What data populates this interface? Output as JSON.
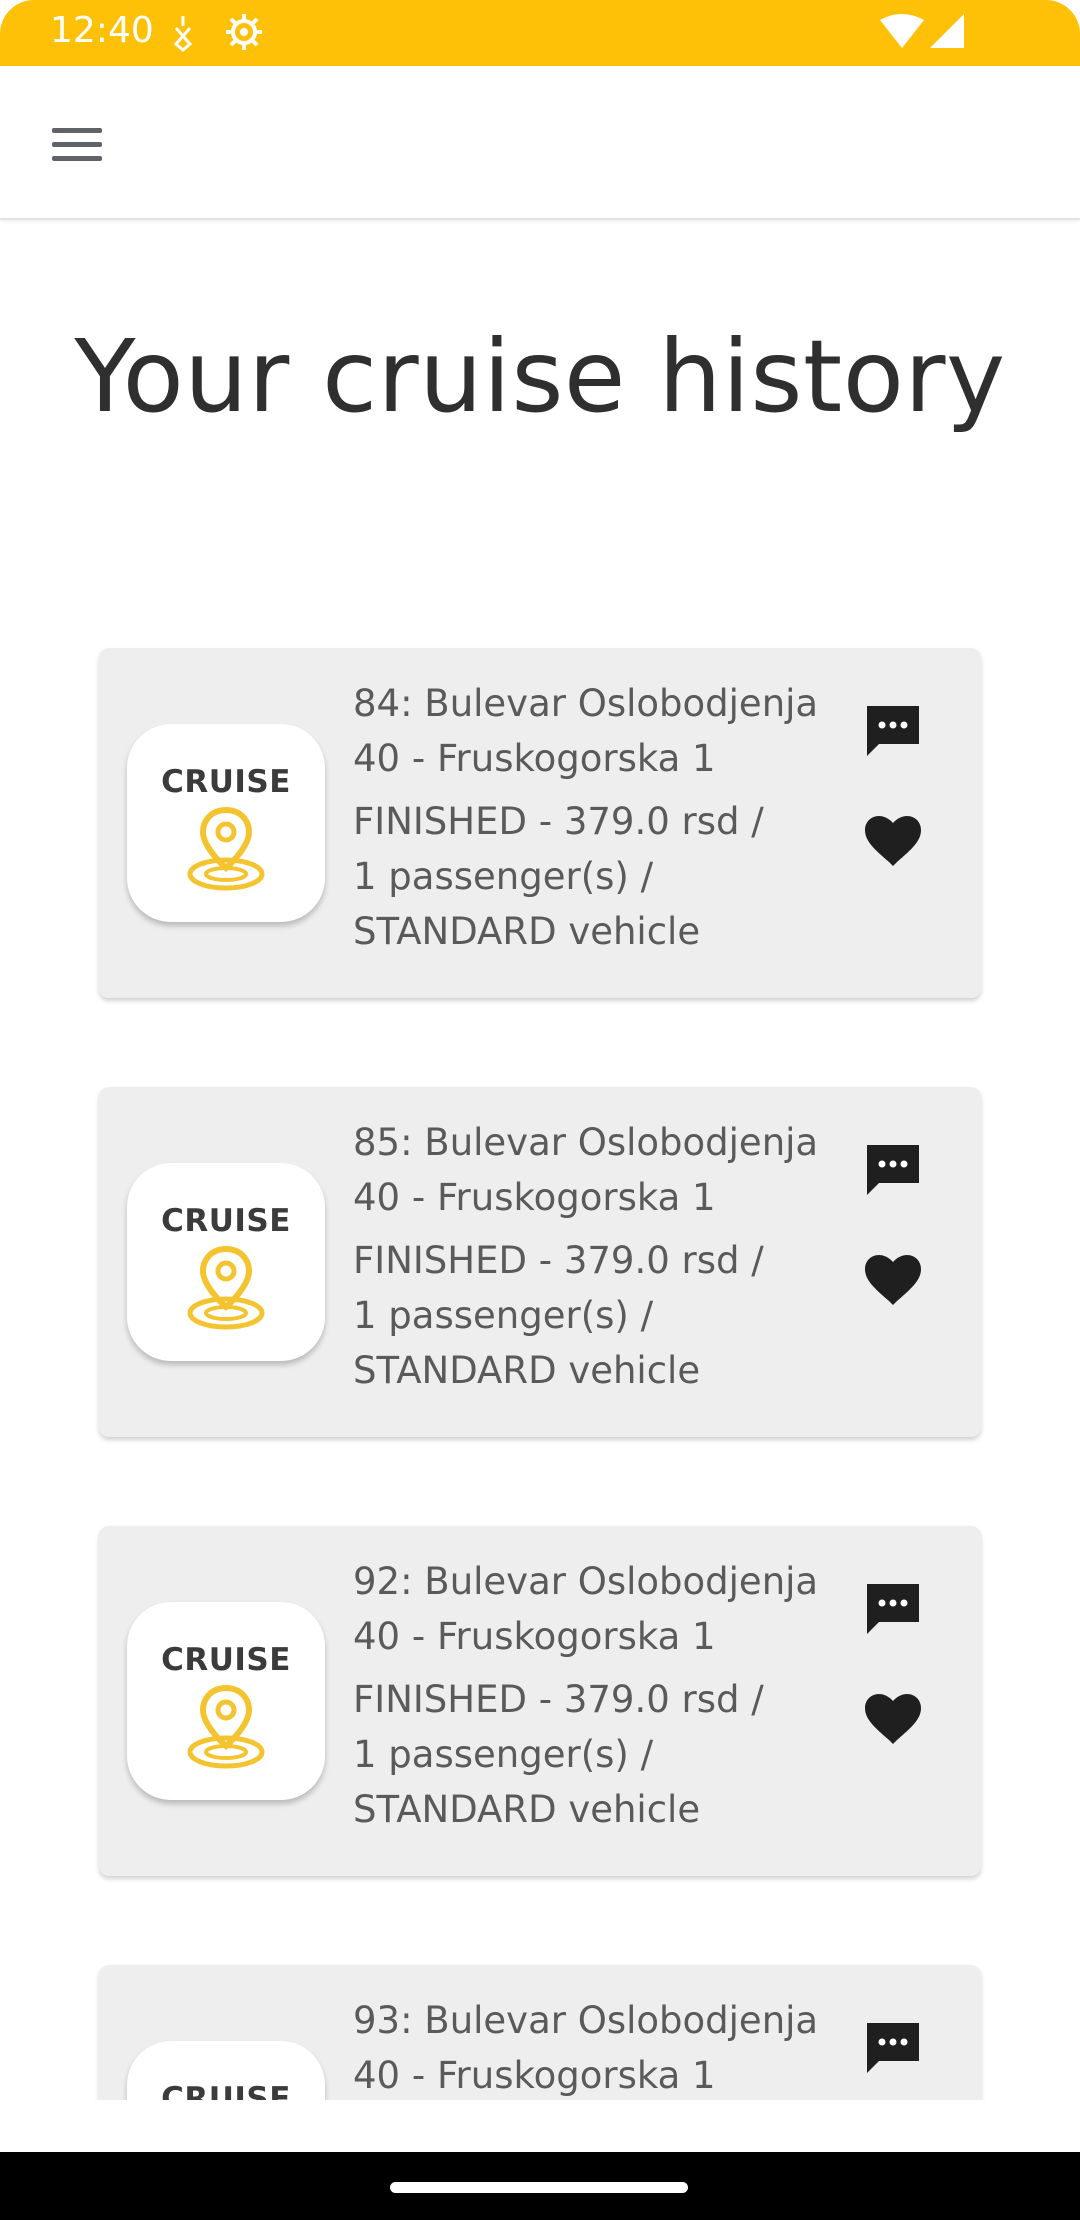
{
  "status_bar": {
    "time": "12:40",
    "background": "#FFC107"
  },
  "app_bar": {
    "menu_icon": "hamburger-menu-icon"
  },
  "page": {
    "title": "Your cruise history"
  },
  "rides": [
    {
      "route_line1": "84: Bulevar Oslobodjenja",
      "route_line2": "40 - Fruskogorska 1",
      "details_line1": "FINISHED - 379.0 rsd /",
      "details_line2": "1 passenger(s) /",
      "details_line3": "STANDARD vehicle",
      "logo_text": "CRUISE"
    },
    {
      "route_line1": "85: Bulevar Oslobodjenja",
      "route_line2": "40 - Fruskogorska 1",
      "details_line1": "FINISHED - 379.0 rsd /",
      "details_line2": "1 passenger(s) /",
      "details_line3": "STANDARD vehicle",
      "logo_text": "CRUISE"
    },
    {
      "route_line1": "92: Bulevar Oslobodjenja",
      "route_line2": "40 - Fruskogorska 1",
      "details_line1": "FINISHED - 379.0 rsd /",
      "details_line2": "1 passenger(s) /",
      "details_line3": "STANDARD vehicle",
      "logo_text": "CRUISE"
    },
    {
      "route_line1": "93: Bulevar Oslobodjenja",
      "route_line2": "40 - Fruskogorska 1",
      "logo_text": "CRUISE"
    }
  ],
  "colors": {
    "accent": "#FFC107",
    "logo_pin": "#F4C430",
    "card_bg": "#EEEEEE"
  }
}
